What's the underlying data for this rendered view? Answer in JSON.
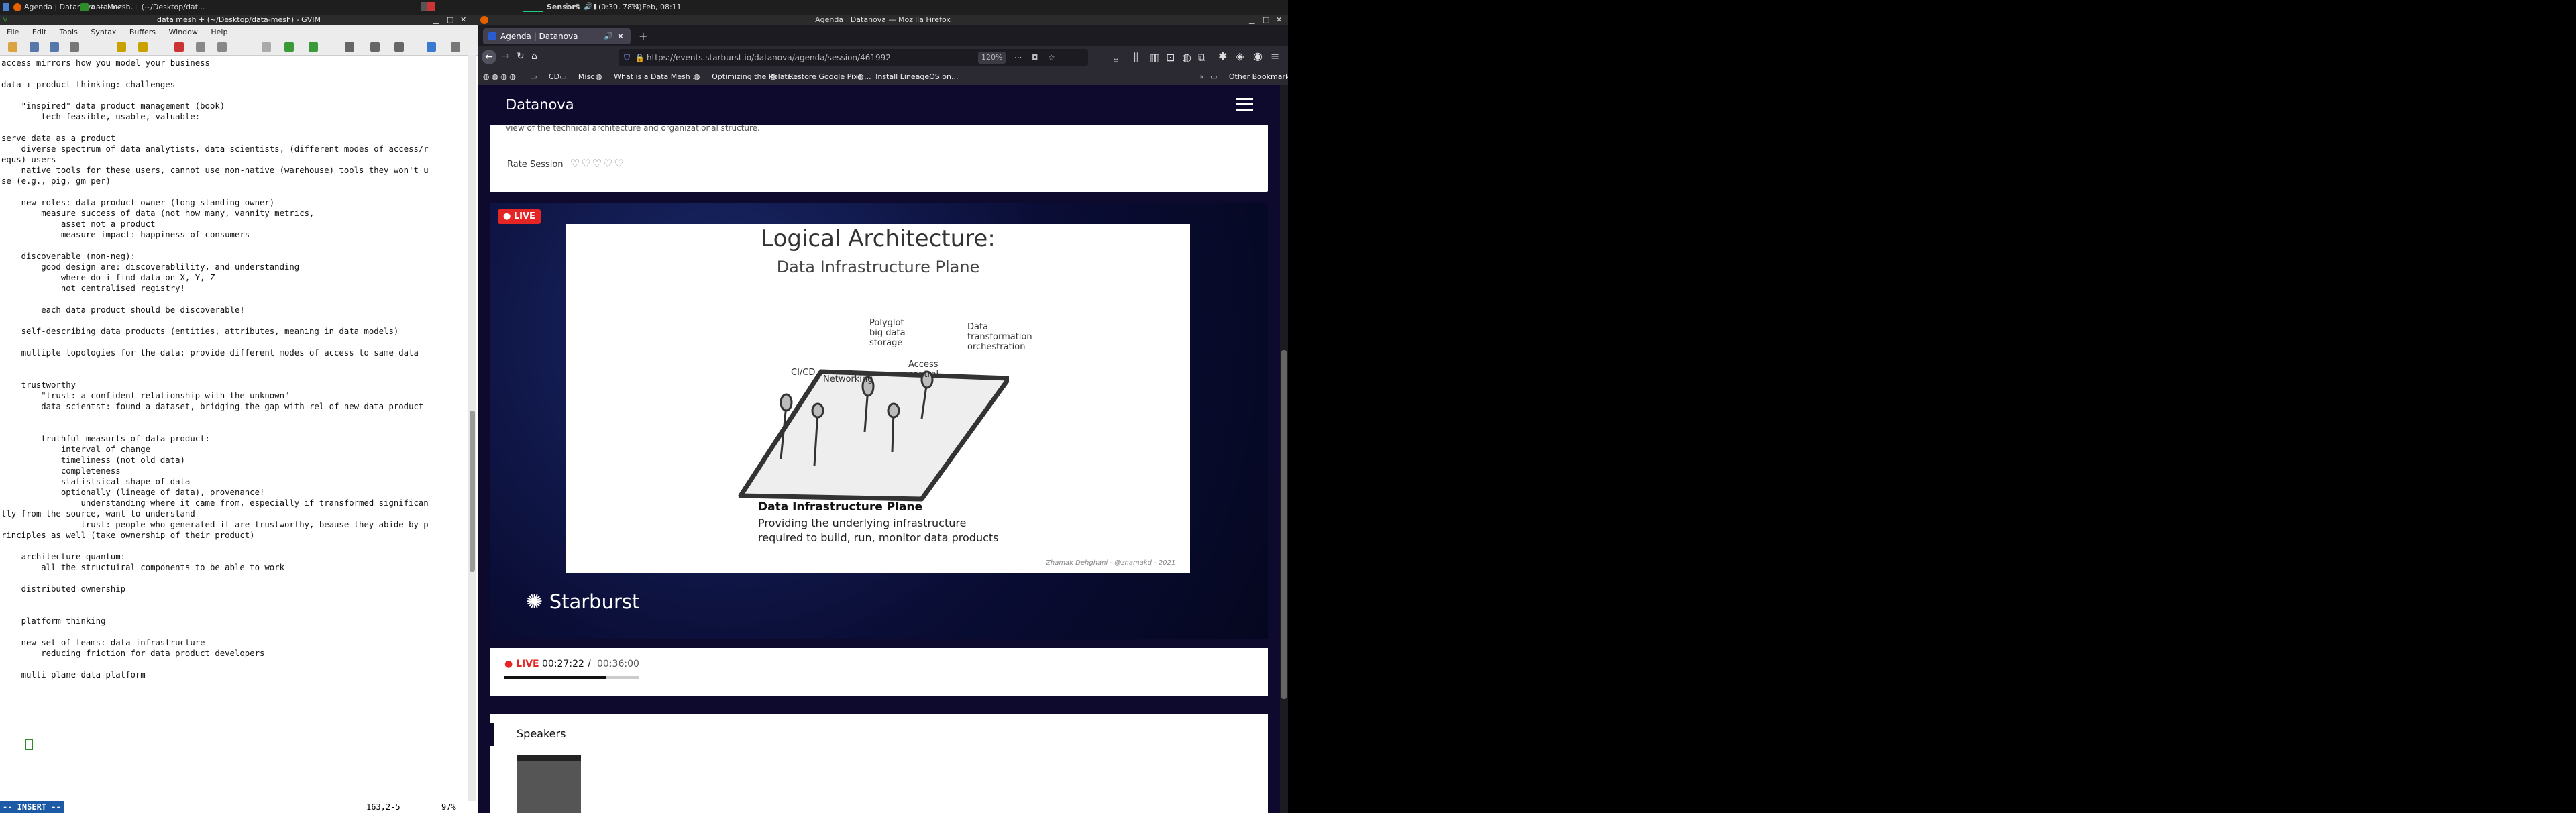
{
  "system_panel": {
    "tasks": [
      "Agenda | Datanova — Mozil...",
      "data mesh + (~/Desktop/dat..."
    ],
    "sensors_label": "Sensors",
    "battery": "(0:30, 78%)",
    "clock": "11 Feb, 08:11"
  },
  "gvim": {
    "title": "data mesh + (~/Desktop/data-mesh) - GVIM",
    "menu": [
      "File",
      "Edit",
      "Tools",
      "Syntax",
      "Buffers",
      "Window",
      "Help"
    ],
    "lines": [
      "access mirrors how you model your business",
      "",
      "data + product thinking: challenges",
      "",
      "    \"inspired\" data product management (book)",
      "        tech feasible, usable, valuable:",
      "",
      "serve data as a product",
      "    diverse spectrum of data analytists, data scientists, (different modes of access/r",
      "equs) users",
      "    native tools for these users, cannot use non-native (warehouse) tools they won't u",
      "se (e.g., pig, gm per)",
      "",
      "    new roles: data product owner (long standing owner)",
      "        measure success of data (not how many, vannity metrics,",
      "            asset not a product",
      "            measure impact: happiness of consumers",
      "",
      "    discoverable (non-neg):",
      "        good design are: discoverablility, and understanding",
      "            where do i find data on X, Y, Z",
      "            not centralised registry!",
      "",
      "        each data product should be discoverable!",
      "",
      "    self-describing data products (entities, attributes, meaning in data models)",
      "",
      "    multiple topologies for the data: provide different modes of access to same data",
      "",
      "",
      "    trustworthy",
      "        \"trust: a confident relationship with the unknown\"",
      "        data scientst: found a dataset, bridging the gap with rel of new data product",
      "",
      "",
      "        truthful measurts of data product:",
      "            interval of change",
      "            timeliness (not old data)",
      "            completeness",
      "            statistsical shape of data",
      "            optionally (lineage of data), provenance!",
      "                understanding where it came from, especially if transformed significan",
      "tly from the source, want to understand",
      "                trust: people who generated it are trustworthy, beause they abide by p",
      "rinciples as well (take ownership of their product)",
      "",
      "    architecture quantum:",
      "        all the structuiral components to be able to work",
      "",
      "    distributed ownership",
      "",
      "",
      "    platform thinking",
      "",
      "    new set of teams: data infrastructure",
      "        reducing friction for data product developers",
      "",
      "    multi-plane data platform",
      ""
    ],
    "mode": "-- INSERT --",
    "position": "163,2-5",
    "percent": "97%"
  },
  "firefox": {
    "window_title": "Agenda | Datanova — Mozilla Firefox",
    "tab_label": "Agenda | Datanova",
    "url": "https://events.starburst.io/datanova/agenda/session/461992",
    "zoom": "120%",
    "bookmarks": [
      "CD",
      "Misc",
      "What is a Data Mesh ...",
      "Optimizing the Relati...",
      "Restore Google Pixel...",
      "Install LineageOS on..."
    ],
    "other_bookmarks": "Other Bookmarks"
  },
  "page": {
    "brand": "Datanova",
    "truncated_text": "view of the technical architecture and organizational structure.",
    "rate_label": "Rate Session",
    "rating": 0,
    "live_badge": "LIVE",
    "slide": {
      "title": "Logical Architecture:",
      "subtitle": "Data Infrastructure Plane",
      "labels": [
        "CI/CD",
        "Networking",
        "Polyglot\nbig data\nstorage",
        "Access\ncontrol",
        "Data\ntransformation\norchestration"
      ],
      "plane_title": "Data Infrastructure Plane",
      "plane_desc_1": "Providing the underlying infrastructure",
      "plane_desc_2": "required to build, run, monitor data products",
      "credit": "Zhamak Dehghani - @zhamakd - 2021"
    },
    "video_brand": "Starburst",
    "player": {
      "live": "LIVE",
      "current": "00:27:22",
      "separator": "/",
      "duration": "00:36:00",
      "progress": 0.76
    },
    "speakers_heading": "Speakers"
  }
}
